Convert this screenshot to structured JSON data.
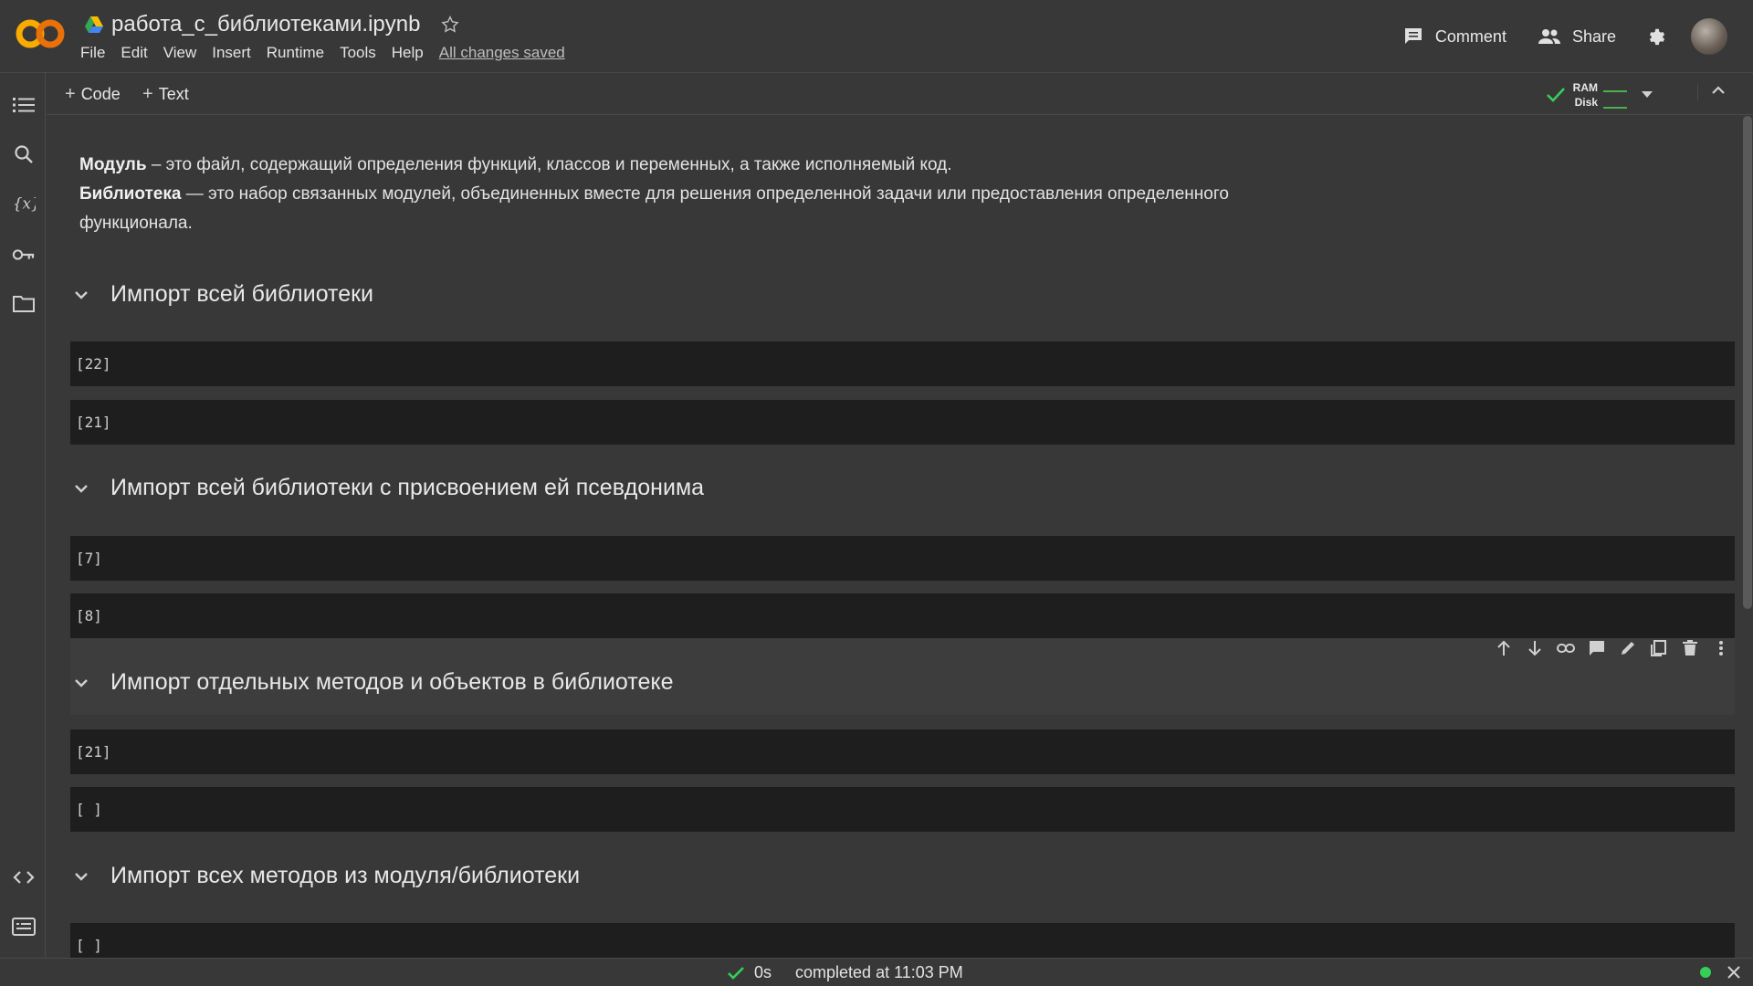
{
  "header": {
    "document_title": "работа_с_библиотеками.ipynb",
    "menu": [
      "File",
      "Edit",
      "View",
      "Insert",
      "Runtime",
      "Tools",
      "Help"
    ],
    "save_status": "All changes saved",
    "comment_label": "Comment",
    "share_label": "Share"
  },
  "toolbar": {
    "add_code_label": "Code",
    "add_text_label": "Text",
    "ram_label": "RAM",
    "disk_label": "Disk"
  },
  "intro": {
    "module_term": "Модуль",
    "module_text": " – это файл, содержащий определения функций, классов и переменных, а также исполняемый код.",
    "library_term": "Библиотека",
    "library_text": " — это набор связанных модулей, объединенных вместе для решения определенной задачи или предоставления определенного функционала."
  },
  "sections": [
    {
      "title": "Импорт всей библиотеки",
      "cells": [
        "[22]",
        "[21]"
      ]
    },
    {
      "title": "Импорт всей библиотеки с присвоением ей псевдонима",
      "cells": [
        "[7]",
        "[8]"
      ]
    },
    {
      "title": "Импорт отдельных методов и объектов в библиотеке",
      "cells": [
        "[21]",
        "[ ]"
      ]
    },
    {
      "title": "Импорт всех методов из модуля/библиотеки",
      "cells": [
        "[ ]"
      ]
    }
  ],
  "status": {
    "duration": "0s",
    "completed_text": "completed at 11:03 PM"
  },
  "colors": {
    "background": "#383838",
    "code_cell": "#1e1e1e",
    "accent_green": "#34d058",
    "logo_orange": "#f9ab00"
  }
}
